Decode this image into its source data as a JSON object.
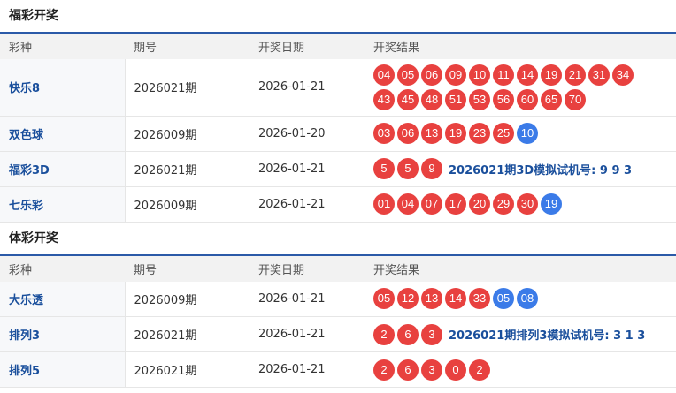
{
  "fucai": {
    "title": "福彩开奖",
    "headers": [
      "彩种",
      "期号",
      "开奖日期",
      "开奖结果"
    ],
    "rows": [
      {
        "name": "快乐8",
        "issue": "2026021期",
        "date": "2026-01-21",
        "red": [
          "04",
          "05",
          "06",
          "09",
          "10",
          "11",
          "14",
          "19",
          "21",
          "31",
          "34",
          "43",
          "45",
          "48",
          "51",
          "53",
          "56",
          "60",
          "65",
          "70"
        ],
        "blue": [],
        "trial": ""
      },
      {
        "name": "双色球",
        "issue": "2026009期",
        "date": "2026-01-20",
        "red": [
          "03",
          "06",
          "13",
          "19",
          "23",
          "25"
        ],
        "blue": [
          "10"
        ],
        "trial": ""
      },
      {
        "name": "福彩3D",
        "issue": "2026021期",
        "date": "2026-01-21",
        "red": [
          "5",
          "5",
          "9"
        ],
        "blue": [],
        "trial": "2026021期3D模拟试机号: 9 9 3"
      },
      {
        "name": "七乐彩",
        "issue": "2026009期",
        "date": "2026-01-21",
        "red": [
          "01",
          "04",
          "07",
          "17",
          "20",
          "29",
          "30"
        ],
        "blue": [
          "19"
        ],
        "trial": ""
      }
    ]
  },
  "ticai": {
    "title": "体彩开奖",
    "headers": [
      "彩种",
      "期号",
      "开奖日期",
      "开奖结果"
    ],
    "rows": [
      {
        "name": "大乐透",
        "issue": "2026009期",
        "date": "2026-01-21",
        "red": [
          "05",
          "12",
          "13",
          "14",
          "33"
        ],
        "blue": [
          "05",
          "08"
        ],
        "trial": ""
      },
      {
        "name": "排列3",
        "issue": "2026021期",
        "date": "2026-01-21",
        "red": [
          "2",
          "6",
          "3"
        ],
        "blue": [],
        "trial": "2026021期排列3模拟试机号: 3 1 3"
      },
      {
        "name": "排列5",
        "issue": "2026021期",
        "date": "2026-01-21",
        "red": [
          "2",
          "6",
          "3",
          "0",
          "2"
        ],
        "blue": [],
        "trial": ""
      }
    ]
  }
}
